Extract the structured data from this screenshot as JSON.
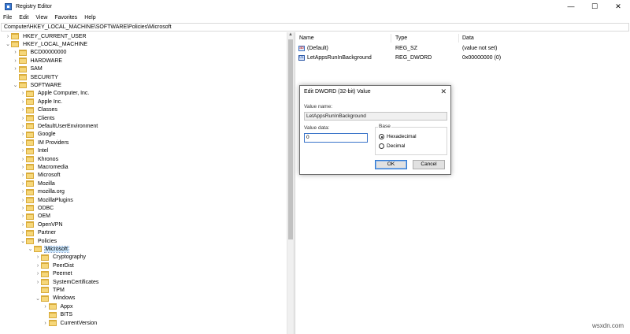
{
  "window": {
    "title": "Registry Editor",
    "controls": {
      "minimize": "—",
      "maximize": "☐",
      "close": "✕"
    }
  },
  "menu": [
    "File",
    "Edit",
    "View",
    "Favorites",
    "Help"
  ],
  "address": "Computer\\HKEY_LOCAL_MACHINE\\SOFTWARE\\Policies\\Microsoft",
  "tree": [
    {
      "label": "HKEY_CURRENT_USER",
      "expanded": false,
      "level": 1
    },
    {
      "label": "HKEY_LOCAL_MACHINE",
      "expanded": true,
      "level": 1
    },
    {
      "label": "BCD00000000",
      "expanded": false,
      "level": 2
    },
    {
      "label": "HARDWARE",
      "expanded": false,
      "level": 2
    },
    {
      "label": "SAM",
      "expanded": false,
      "level": 2
    },
    {
      "label": "SECURITY",
      "expanded": null,
      "level": 2
    },
    {
      "label": "SOFTWARE",
      "expanded": true,
      "level": 2
    },
    {
      "label": "Apple Computer, Inc.",
      "expanded": false,
      "level": 3
    },
    {
      "label": "Apple Inc.",
      "expanded": false,
      "level": 3
    },
    {
      "label": "Classes",
      "expanded": false,
      "level": 3
    },
    {
      "label": "Clients",
      "expanded": false,
      "level": 3
    },
    {
      "label": "DefaultUserEnvironment",
      "expanded": false,
      "level": 3
    },
    {
      "label": "Google",
      "expanded": false,
      "level": 3
    },
    {
      "label": "IM Providers",
      "expanded": false,
      "level": 3
    },
    {
      "label": "Intel",
      "expanded": false,
      "level": 3
    },
    {
      "label": "Khronos",
      "expanded": false,
      "level": 3
    },
    {
      "label": "Macromedia",
      "expanded": false,
      "level": 3
    },
    {
      "label": "Microsoft",
      "expanded": false,
      "level": 3
    },
    {
      "label": "Mozilla",
      "expanded": false,
      "level": 3
    },
    {
      "label": "mozilla.org",
      "expanded": false,
      "level": 3
    },
    {
      "label": "MozillaPlugins",
      "expanded": false,
      "level": 3
    },
    {
      "label": "ODBC",
      "expanded": false,
      "level": 3
    },
    {
      "label": "OEM",
      "expanded": false,
      "level": 3
    },
    {
      "label": "OpenVPN",
      "expanded": false,
      "level": 3
    },
    {
      "label": "Partner",
      "expanded": false,
      "level": 3
    },
    {
      "label": "Policies",
      "expanded": true,
      "level": 3
    },
    {
      "label": "Microsoft",
      "expanded": true,
      "level": 4,
      "selected": true
    },
    {
      "label": "Cryptography",
      "expanded": false,
      "level": 5
    },
    {
      "label": "PeerDist",
      "expanded": false,
      "level": 5
    },
    {
      "label": "Peernet",
      "expanded": false,
      "level": 5
    },
    {
      "label": "SystemCertificates",
      "expanded": false,
      "level": 5
    },
    {
      "label": "TPM",
      "expanded": null,
      "level": 5
    },
    {
      "label": "Windows",
      "expanded": true,
      "level": 5
    },
    {
      "label": "Appx",
      "expanded": false,
      "level": 6
    },
    {
      "label": "BITS",
      "expanded": null,
      "level": 6
    },
    {
      "label": "CurrentVersion",
      "expanded": false,
      "level": 6
    }
  ],
  "values": {
    "headers": {
      "name": "Name",
      "type": "Type",
      "data": "Data"
    },
    "rows": [
      {
        "icon": "string-value-icon",
        "badge": "ab",
        "name": "(Default)",
        "type": "REG_SZ",
        "data": "(value not set)"
      },
      {
        "icon": "dword-value-icon",
        "badge": "01",
        "name": "LetAppsRunInBackground",
        "type": "REG_DWORD",
        "data": "0x00000000 (0)"
      }
    ]
  },
  "dialog": {
    "title": "Edit DWORD (32-bit) Value",
    "close": "✕",
    "value_name_label": "Value name:",
    "value_name": "LetAppsRunInBackground",
    "value_data_label": "Value data:",
    "value_data": "0",
    "base_label": "Base",
    "base_options": [
      "Hexadecimal",
      "Decimal"
    ],
    "base_selected": "Hexadecimal",
    "ok_label": "OK",
    "cancel_label": "Cancel"
  },
  "watermark": "wsxdn.com",
  "colors": {
    "folder": "#f6d77a",
    "selection": "#cce8ff",
    "accent": "#2f78d1"
  }
}
